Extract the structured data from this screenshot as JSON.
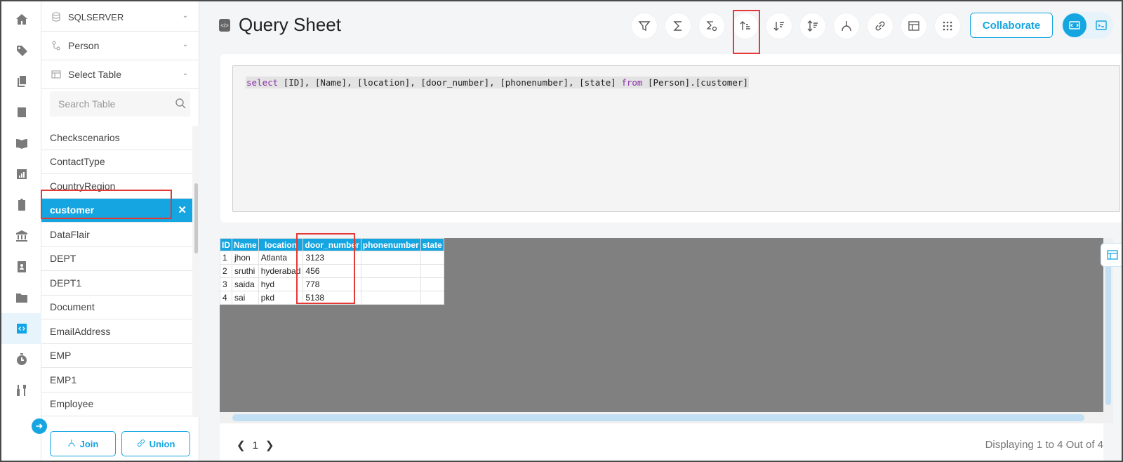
{
  "nav_rail": {
    "icons": [
      "home-icon",
      "tag-icon",
      "copy-icon",
      "book-icon",
      "open-book-icon",
      "report-icon",
      "clipboard-icon",
      "bank-icon",
      "contact-icon",
      "folder-icon",
      "code-icon",
      "timer-icon",
      "tools-icon"
    ],
    "active": "code-icon"
  },
  "panel": {
    "datasource": "SQLSERVER",
    "schema": "Person",
    "table_select": "Select Table",
    "search_placeholder": "Search Table",
    "tables": [
      "Checkscenarios",
      "ContactType",
      "CountryRegion",
      "customer",
      "DataFlair",
      "DEPT",
      "DEPT1",
      "Document",
      "EmailAddress",
      "EMP",
      "EMP1",
      "Employee"
    ],
    "selected_table": "customer",
    "join_label": "Join",
    "union_label": "Union"
  },
  "header": {
    "title": "Query Sheet",
    "collaborate_label": "Collaborate"
  },
  "toolbar": [
    "filter-icon",
    "sigma-icon",
    "formula-settings-icon",
    "sort-ascending-icon",
    "sort-descending-icon",
    "sort-icon",
    "merge-icon",
    "link-icon",
    "table-icon",
    "grid-dots-icon"
  ],
  "editor": {
    "keyword_select": "select",
    "columns": "[ID], [Name], [location], [door_number], [phonenumber], [state]",
    "keyword_from": "from",
    "source": "[Person].[customer]"
  },
  "results": {
    "columns": [
      "ID",
      "Name",
      "location",
      "door_number",
      "phonenumber",
      "state"
    ],
    "rows": [
      [
        "1",
        "jhon",
        "Atlanta",
        "3123",
        "",
        ""
      ],
      [
        "2",
        "sruthi",
        "hyderabad",
        "456",
        "",
        ""
      ],
      [
        "3",
        "saida",
        "hyd",
        "778",
        "",
        ""
      ],
      [
        "4",
        "sai",
        "pkd",
        "5138",
        "",
        ""
      ]
    ]
  },
  "footer": {
    "page": "1",
    "display_text": "Displaying 1 to 4 Out of 4"
  },
  "colors": {
    "accent": "#15a5e0",
    "highlight": "#e53935"
  }
}
